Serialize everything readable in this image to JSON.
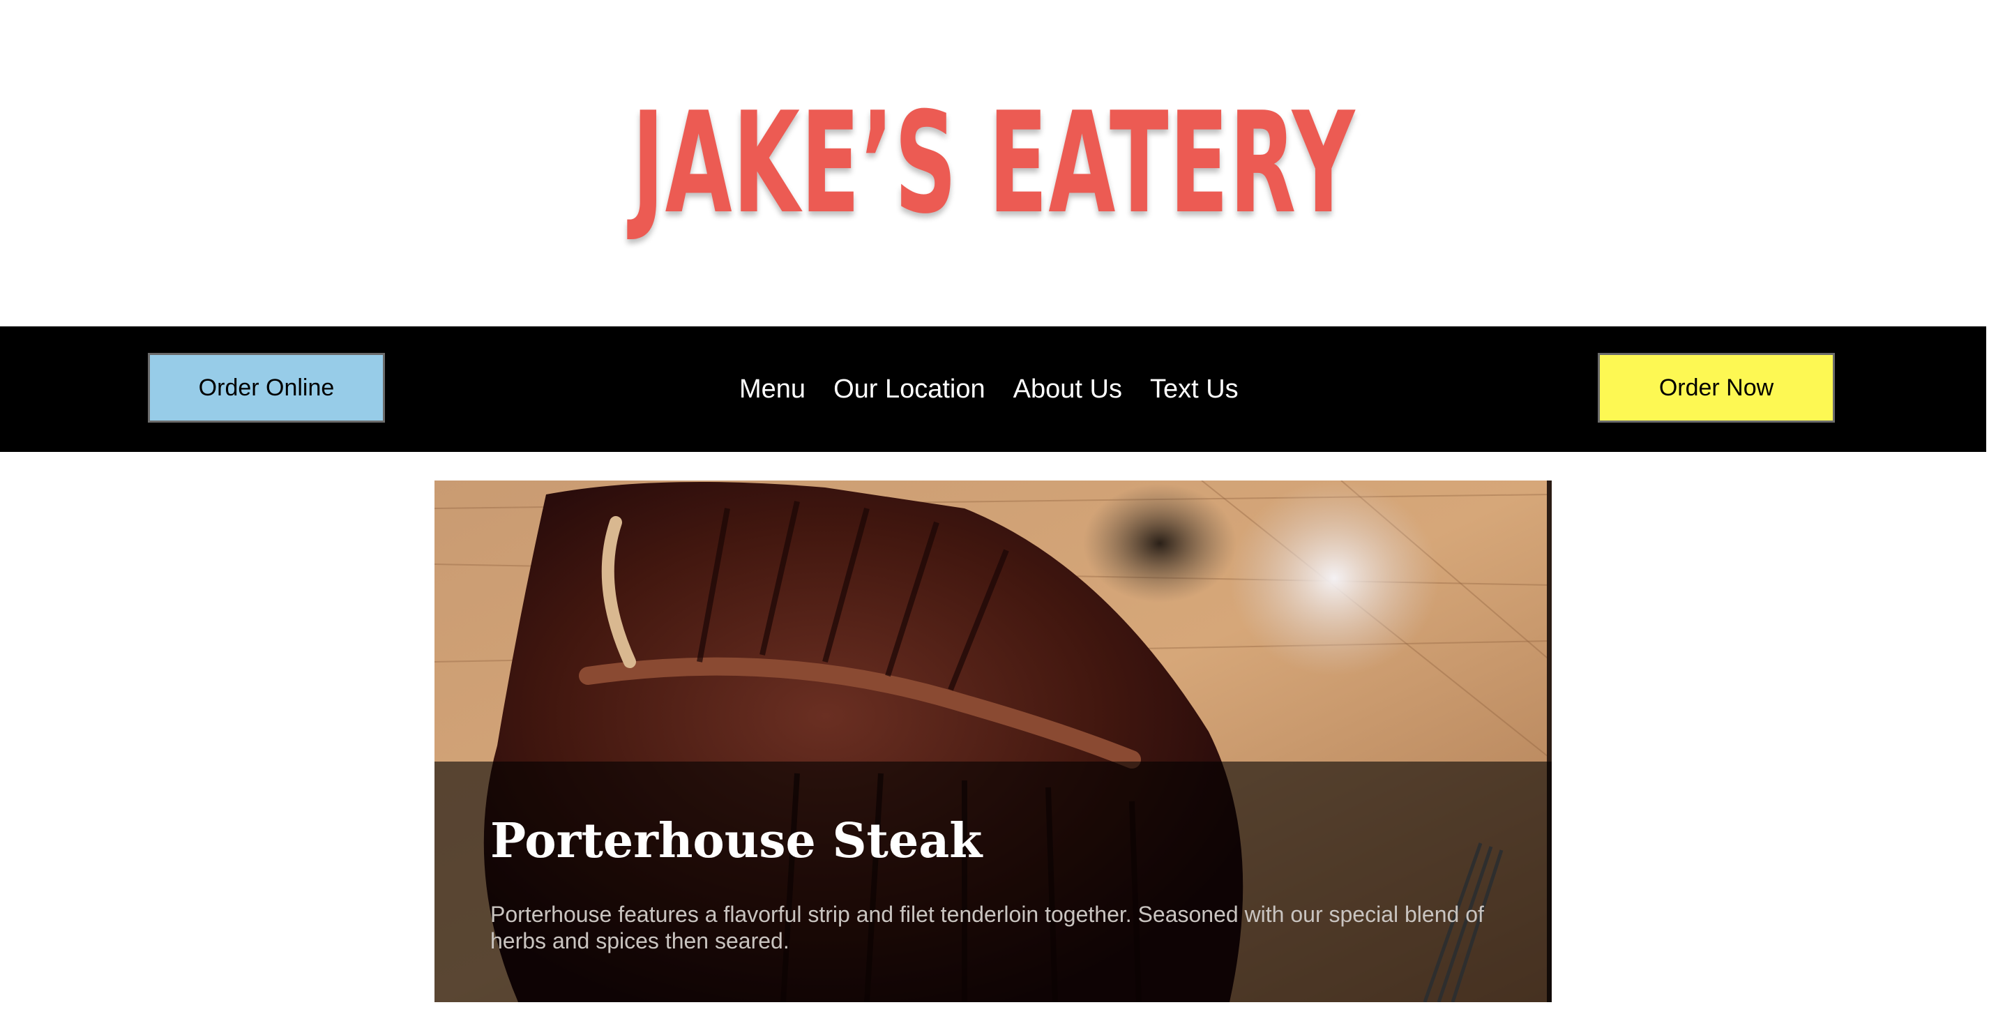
{
  "brand": {
    "logo_text": "JAKE’S EATERY",
    "logo_color": "#ec5b53"
  },
  "navbar": {
    "background": "#000000",
    "order_online_label": "Order Online",
    "order_online_color": "#97cce8",
    "links": [
      {
        "label": "Menu"
      },
      {
        "label": "Our Location"
      },
      {
        "label": "About Us"
      },
      {
        "label": "Text Us"
      }
    ],
    "order_now_label": "Order Now",
    "order_now_color": "#fdf853"
  },
  "hero": {
    "image_icon": "steak-photo",
    "title": "Porterhouse Steak",
    "description": "Porterhouse features a flavorful strip and filet tenderloin together. Seasoned with our special blend of herbs and spices then seared."
  }
}
